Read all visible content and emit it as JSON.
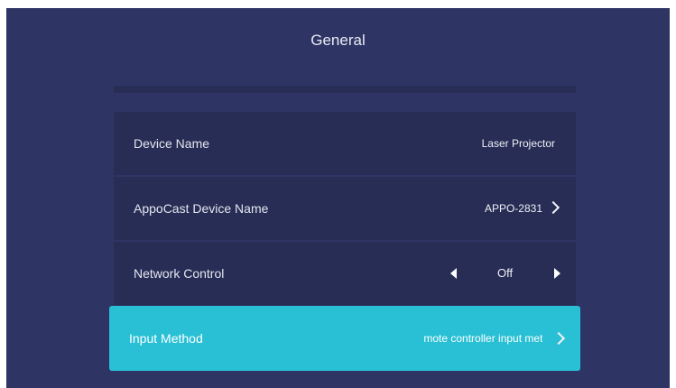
{
  "header": {
    "title": "General"
  },
  "settings": {
    "device_name": {
      "label": "Device Name",
      "value": "Laser Projector"
    },
    "appocast": {
      "label": "AppoCast Device Name",
      "value": "APPO-2831"
    },
    "network_control": {
      "label": "Network Control",
      "value": "Off"
    },
    "input_method": {
      "label": "Input Method",
      "value": "Remote controller input method"
    }
  },
  "icons": {
    "appocast_arrow": "chevron-right-icon",
    "network_prev": "triangle-left-icon",
    "network_next": "triangle-right-icon",
    "input_arrow": "chevron-right-icon"
  },
  "colors": {
    "screen_bg": "#2e3564",
    "row_bg": "#272d55",
    "selected_bg": "#29c0d5"
  }
}
